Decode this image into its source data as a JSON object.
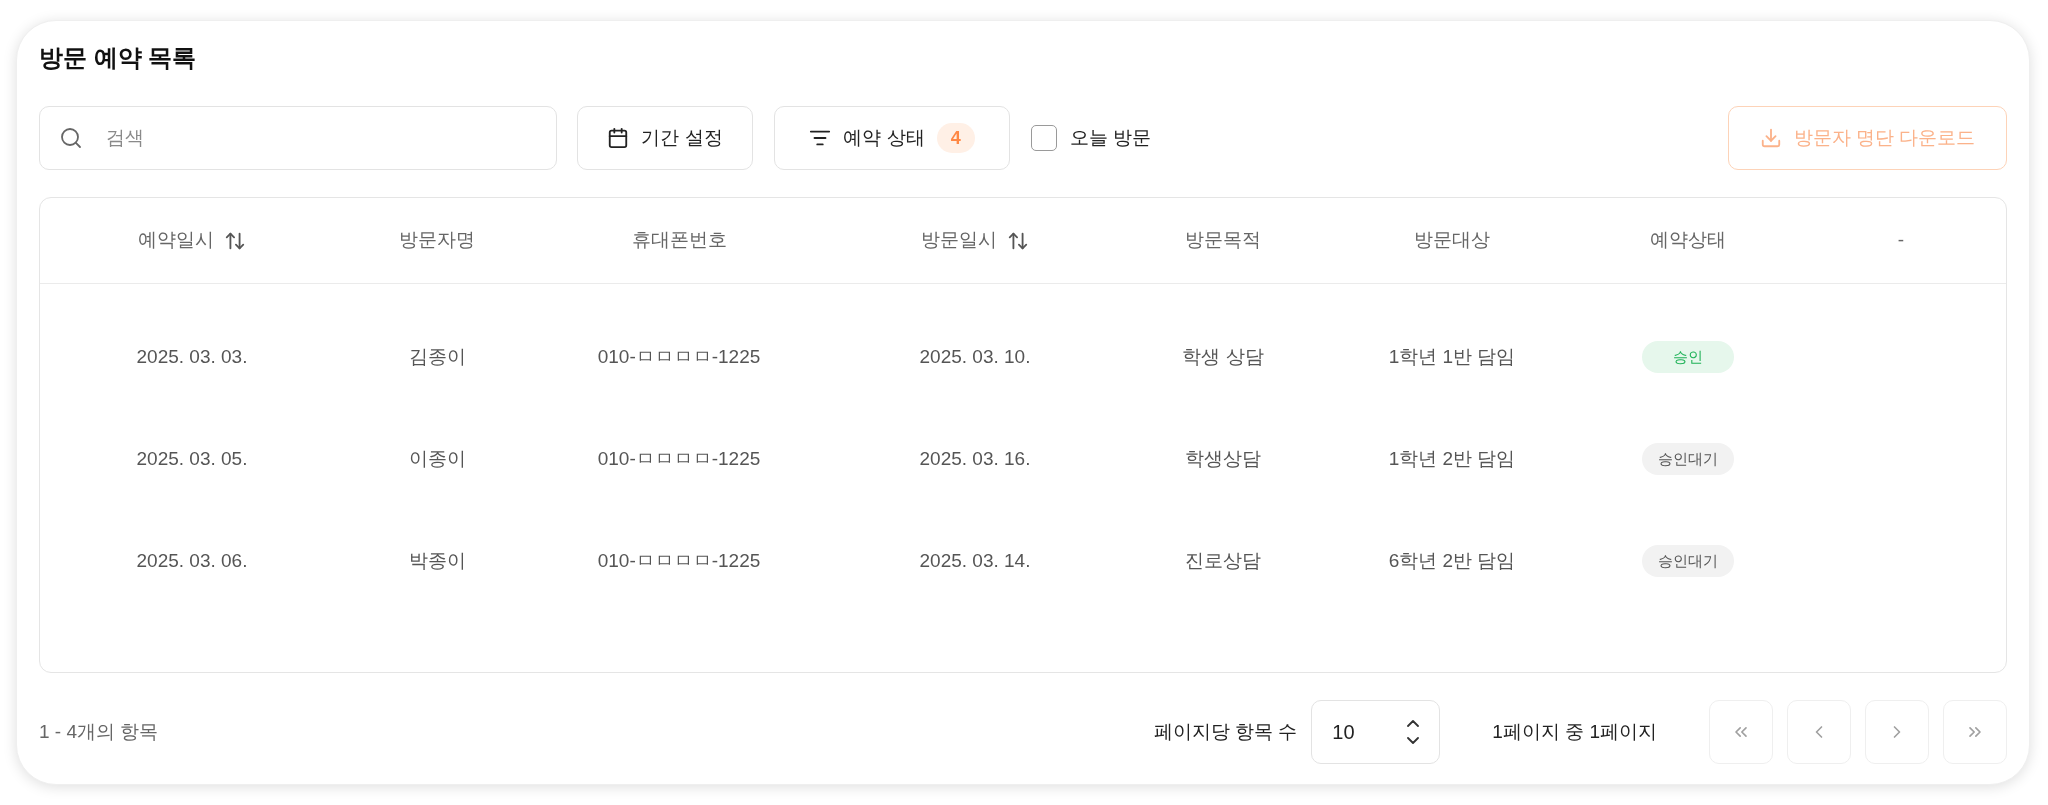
{
  "title": "방문 예약 목록",
  "toolbar": {
    "search": {
      "placeholder": "검색"
    },
    "date_button": {
      "label": "기간 설정"
    },
    "status_filter": {
      "label": "예약 상태",
      "count": "4"
    },
    "today_filter": {
      "label": "오늘 방문",
      "checked": false
    },
    "download_button": {
      "label": "방문자 명단 다운로드",
      "disabled": true
    }
  },
  "table": {
    "columns": [
      {
        "label": "예약일시",
        "sortable": true
      },
      {
        "label": "방문자명",
        "sortable": false
      },
      {
        "label": "휴대폰번호",
        "sortable": false
      },
      {
        "label": "방문일시",
        "sortable": true
      },
      {
        "label": "방문목적",
        "sortable": false
      },
      {
        "label": "방문대상",
        "sortable": false
      },
      {
        "label": "예약상태",
        "sortable": false
      },
      {
        "label": "-",
        "sortable": false
      }
    ],
    "rows": [
      {
        "reserved_at": "2025. 03. 03.",
        "visitor": "김종이",
        "phone": "010-ㅁㅁㅁㅁ-1225",
        "visit_at": "2025. 03. 10.",
        "purpose": "학생 상담",
        "target": "1학년 1반 담임",
        "status": {
          "label": "승인",
          "kind": "approved"
        }
      },
      {
        "reserved_at": "2025. 03. 05.",
        "visitor": "이종이",
        "phone": "010-ㅁㅁㅁㅁ-1225",
        "visit_at": "2025. 03. 16.",
        "purpose": "학생상담",
        "target": "1학년 2반 담임",
        "status": {
          "label": "승인대기",
          "kind": "pending"
        }
      },
      {
        "reserved_at": "2025. 03. 06.",
        "visitor": "박종이",
        "phone": "010-ㅁㅁㅁㅁ-1225",
        "visit_at": "2025. 03. 14.",
        "purpose": "진로상담",
        "target": "6학년 2반 담임",
        "status": {
          "label": "승인대기",
          "kind": "pending"
        }
      }
    ]
  },
  "footer": {
    "item_count": "1 - 4개의 항목",
    "page_size_label": "페이지당 항목 수",
    "page_size": "10",
    "page_info": "1페이지 중 1페이지",
    "pager": [
      {
        "kind": "first",
        "disabled": true
      },
      {
        "kind": "previous",
        "disabled": true
      },
      {
        "kind": "next",
        "disabled": true
      },
      {
        "kind": "last",
        "disabled": true
      }
    ]
  }
}
